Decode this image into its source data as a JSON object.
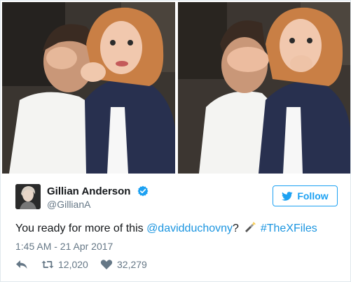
{
  "user": {
    "name": "Gillian Anderson",
    "handle": "@GillianA"
  },
  "follow": {
    "label": "Follow"
  },
  "tweet": {
    "prefix": "You ready for more of this ",
    "mention": "@davidduchovny",
    "question": "?",
    "hashtag": "#TheXFiles",
    "timestamp": "1:45 AM - 21 Apr 2017"
  },
  "stats": {
    "retweets": "12,020",
    "likes": "32,279"
  },
  "icons": {
    "verified": "verified-badge-icon",
    "bird": "twitter-bird-icon",
    "flashlight": "flashlight-icon",
    "reply": "reply-icon",
    "retweet": "retweet-icon",
    "like": "heart-icon"
  },
  "colors": {
    "accent": "#1da1f2",
    "link": "#1b95e0",
    "muted": "#657786",
    "text": "#14171a"
  }
}
